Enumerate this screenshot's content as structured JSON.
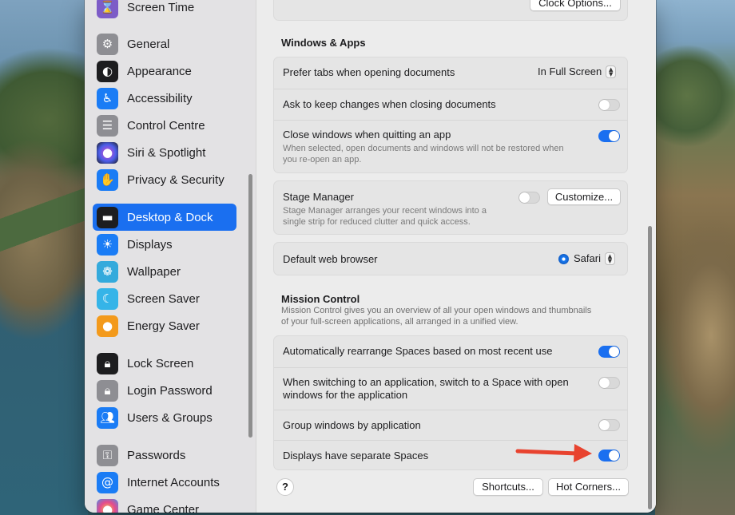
{
  "colors": {
    "accent": "#1a6ff0",
    "arrow": "#e8432f"
  },
  "sidebar": {
    "items": [
      {
        "label": "Screen Time",
        "icon": "hourglass-icon",
        "color": "#7d5cc7"
      },
      {
        "label": "General",
        "icon": "gear-icon",
        "color": "#8e8e93"
      },
      {
        "label": "Appearance",
        "icon": "appearance-icon",
        "color": "#1d1d1f"
      },
      {
        "label": "Accessibility",
        "icon": "accessibility-icon",
        "color": "#1a7cf5"
      },
      {
        "label": "Control Centre",
        "icon": "control-centre-icon",
        "color": "#8e8e93"
      },
      {
        "label": "Siri & Spotlight",
        "icon": "siri-icon",
        "color": "#6a3fd0"
      },
      {
        "label": "Privacy & Security",
        "icon": "hand-icon",
        "color": "#1a7cf5"
      },
      {
        "label": "Desktop & Dock",
        "icon": "dock-icon",
        "color": "#1d1d1f"
      },
      {
        "label": "Displays",
        "icon": "sun-icon",
        "color": "#1a7cf5"
      },
      {
        "label": "Wallpaper",
        "icon": "flower-icon",
        "color": "#34aadc"
      },
      {
        "label": "Screen Saver",
        "icon": "moon-icon",
        "color": "#35b4e8"
      },
      {
        "label": "Energy Saver",
        "icon": "bulb-icon",
        "color": "#f39a1c"
      },
      {
        "label": "Lock Screen",
        "icon": "lock-screen-icon",
        "color": "#1d1d1f"
      },
      {
        "label": "Login Password",
        "icon": "lock-icon",
        "color": "#8e8e93"
      },
      {
        "label": "Users & Groups",
        "icon": "users-icon",
        "color": "#1a7cf5"
      },
      {
        "label": "Passwords",
        "icon": "key-icon",
        "color": "#8e8e93"
      },
      {
        "label": "Internet Accounts",
        "icon": "at-icon",
        "color": "#1a7cf5"
      },
      {
        "label": "Game Center",
        "icon": "game-center-icon",
        "color": "#e64a8c"
      }
    ]
  },
  "main": {
    "clock_options": "Clock Options...",
    "windows_apps_title": "Windows & Apps",
    "prefer_tabs_label": "Prefer tabs when opening documents",
    "prefer_tabs_value": "In Full Screen",
    "ask_keep_label": "Ask to keep changes when closing documents",
    "close_windows_label": "Close windows when quitting an app",
    "close_windows_sub1": "When selected, open documents and windows will not be restored when",
    "close_windows_sub2": "you re-open an app.",
    "stage_manager_label": "Stage Manager",
    "stage_manager_sub1": "Stage Manager arranges your recent windows into a",
    "stage_manager_sub2": "single strip for reduced clutter and quick access.",
    "customize": "Customize...",
    "browser_label": "Default web browser",
    "browser_value": "Safari",
    "mission_title": "Mission Control",
    "mission_desc1": "Mission Control gives you an overview of all your open windows and thumbnails",
    "mission_desc2": "of your full-screen applications, all arranged in a unified view.",
    "auto_rearrange_label": "Automatically rearrange Spaces based on most recent use",
    "switch_space_label1": "When switching to an application, switch to a Space with open",
    "switch_space_label2": "windows for the application",
    "group_windows_label": "Group windows by application",
    "separate_spaces_label": "Displays have separate Spaces",
    "help": "?",
    "shortcuts": "Shortcuts...",
    "hot_corners": "Hot Corners..."
  },
  "toggles": {
    "ask_keep": false,
    "close_windows": true,
    "stage_manager": false,
    "auto_rearrange": true,
    "switch_space": false,
    "group_windows": false,
    "separate_spaces": true
  }
}
